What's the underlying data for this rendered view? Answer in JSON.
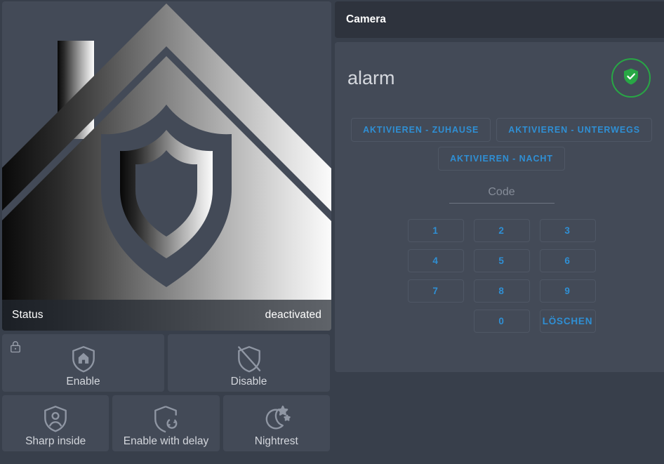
{
  "left": {
    "picture": {
      "name": "house-shield-picture",
      "status_label": "Status",
      "status_value": "deactivated"
    },
    "tiles_row1": [
      {
        "label": "Enable",
        "icon": "shield-home-icon",
        "lock": "lock-icon"
      },
      {
        "label": "Disable",
        "icon": "shield-off-icon",
        "lock": ""
      }
    ],
    "tiles_row2": [
      {
        "label": "Sharp inside",
        "icon": "shield-account-icon"
      },
      {
        "label": "Enable with delay",
        "icon": "shield-refresh-icon"
      },
      {
        "label": "Nightrest",
        "icon": "moon-stars-icon"
      }
    ]
  },
  "right": {
    "header_title": "Camera",
    "alarm": {
      "title": "alarm",
      "badge_icon": "shield-check-icon",
      "badge_color": "#28a745",
      "mode_buttons_row1": [
        "AKTIVIEREN - ZUHAUSE",
        "AKTIVIEREN - UNTERWEGS"
      ],
      "mode_buttons_row2": [
        "AKTIVIEREN - NACHT"
      ],
      "code_placeholder": "Code",
      "code_value": "",
      "keypad": [
        "1",
        "2",
        "3",
        "4",
        "5",
        "6",
        "7",
        "8",
        "9",
        "",
        "0",
        "LÖSCHEN"
      ]
    }
  },
  "colors": {
    "page_bg": "#383f4b",
    "card_bg": "#434a57",
    "header_bg": "#2e333d",
    "accent_blue": "#2f8fd4",
    "text_primary": "#d5d8de",
    "success_green": "#28a745"
  }
}
